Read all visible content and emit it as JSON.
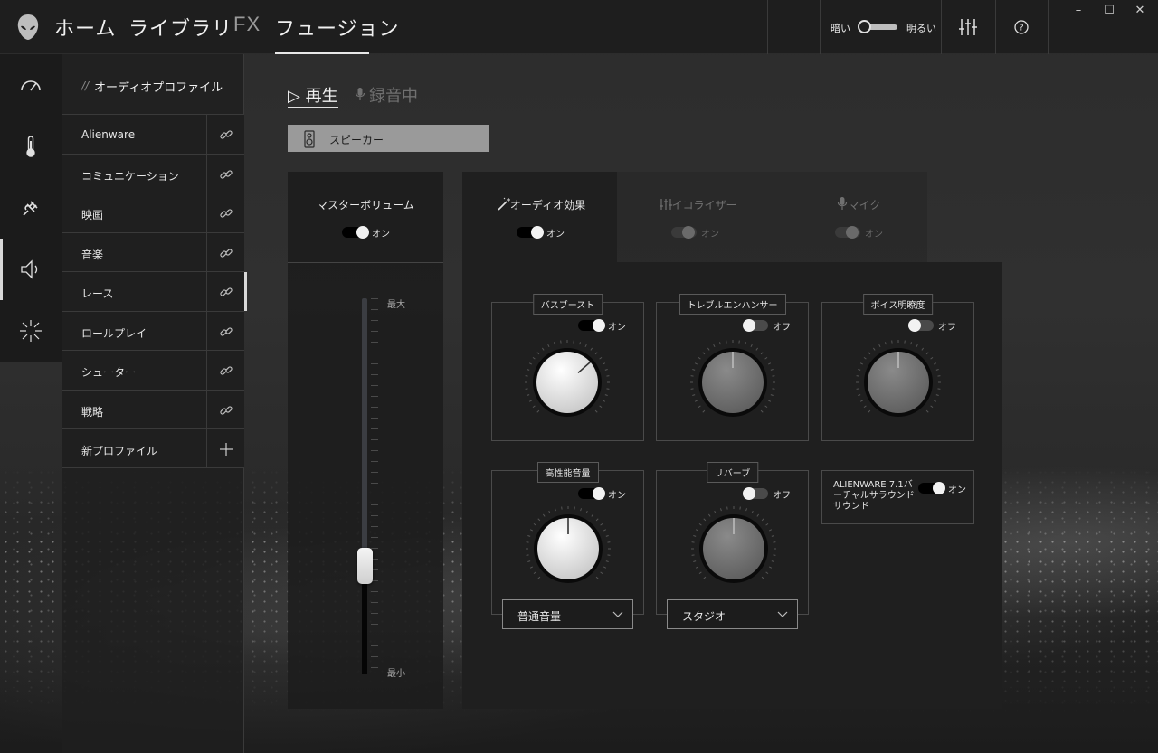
{
  "nav": {
    "home": "ホーム",
    "library": "ライブラリ",
    "fx": "FX",
    "fusion": "フュージョン"
  },
  "theme": {
    "dark_label": "暗い",
    "light_label": "明るい"
  },
  "window_controls": {
    "minimize": "–",
    "maximize": "☐",
    "close": "✕"
  },
  "rail": [
    "gauge-icon",
    "thermometer-icon",
    "power-plug-icon",
    "speaker-icon",
    "burst-icon"
  ],
  "profiles": {
    "slashes": "//",
    "header": "オーディオプロファイル",
    "items": [
      {
        "label": "Alienware"
      },
      {
        "label": "コミュニケーション"
      },
      {
        "label": "映画"
      },
      {
        "label": "音楽"
      },
      {
        "label": "レース"
      },
      {
        "label": "ロールプレイ"
      },
      {
        "label": "シューター"
      },
      {
        "label": "戦略"
      }
    ],
    "new_profile": "新プロファイル"
  },
  "mode_tabs": {
    "play": "▷ 再生",
    "record": "録音中"
  },
  "device": {
    "label": "スピーカー"
  },
  "master_volume": {
    "title": "マスターボリューム",
    "toggle": "オン",
    "max_label": "最大",
    "min_label": "最小",
    "level": 0.27
  },
  "fx_tabs": {
    "audio_effects": {
      "label": "オーディオ効果",
      "toggle": "オン"
    },
    "equalizer": {
      "label": "イコライザー",
      "toggle": "オン"
    },
    "mic": {
      "label": "マイク",
      "toggle": "オン"
    }
  },
  "effects": {
    "bass_boost": {
      "label": "バスブースト",
      "toggle": "オン",
      "level": 0.68
    },
    "treble": {
      "label": "トレブルエンハンサー",
      "toggle": "オフ",
      "level": 0.5
    },
    "voice": {
      "label": "ボイス明瞭度",
      "toggle": "オフ",
      "level": 0.5
    },
    "loudness": {
      "label": "高性能音量",
      "toggle": "オン",
      "level": 0.5,
      "dropdown": "普通音量"
    },
    "reverb": {
      "label": "リバーブ",
      "toggle": "オフ",
      "level": 0.5,
      "dropdown": "スタジオ"
    },
    "surround": {
      "label": "ALIENWARE 7.1バーチャルサラウンドサウンド",
      "toggle": "オン"
    }
  },
  "colors": {
    "accent": "#e8e8e8",
    "panel": "#1f1f1f"
  }
}
